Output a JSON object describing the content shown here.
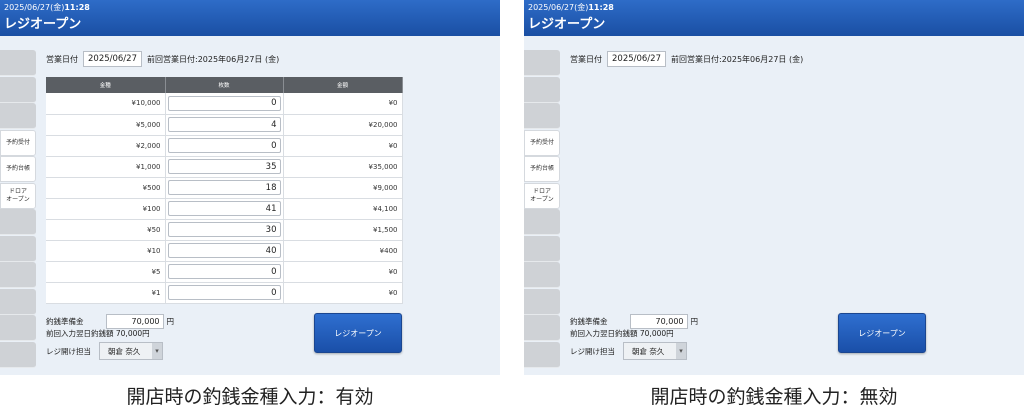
{
  "header": {
    "date": "2025/06/27(金)",
    "time": "11:28",
    "title": "レジオープン"
  },
  "sidebar": {
    "items": [
      "",
      "",
      "",
      "予約受付",
      "予約台帳",
      "ドロア\nオープン",
      "",
      "",
      "",
      "",
      "",
      ""
    ]
  },
  "business_date": {
    "label": "営業日付",
    "value": "2025/06/27",
    "prev": "前回営業日付:2025年06月27日 (金)"
  },
  "table": {
    "headers": [
      "金種",
      "枚数",
      "金額"
    ],
    "rows": [
      {
        "denom": "¥10,000",
        "count": "0",
        "amount": "¥0"
      },
      {
        "denom": "¥5,000",
        "count": "4",
        "amount": "¥20,000"
      },
      {
        "denom": "¥2,000",
        "count": "0",
        "amount": "¥0"
      },
      {
        "denom": "¥1,000",
        "count": "35",
        "amount": "¥35,000"
      },
      {
        "denom": "¥500",
        "count": "18",
        "amount": "¥9,000"
      },
      {
        "denom": "¥100",
        "count": "41",
        "amount": "¥4,100"
      },
      {
        "denom": "¥50",
        "count": "30",
        "amount": "¥1,500"
      },
      {
        "denom": "¥10",
        "count": "40",
        "amount": "¥400"
      },
      {
        "denom": "¥5",
        "count": "0",
        "amount": "¥0"
      },
      {
        "denom": "¥1",
        "count": "0",
        "amount": "¥0"
      }
    ]
  },
  "float": {
    "label": "釣銭準備金",
    "value": "70,000",
    "unit": "円"
  },
  "prev_float": {
    "label": "前回入力翌日釣銭額",
    "value": "70,000円"
  },
  "staff": {
    "label": "レジ開け担当",
    "value": "朝倉 奈久"
  },
  "open_button": "レジオープン",
  "captions": {
    "left": "開店時の釣銭金種入力：有効",
    "right": "開店時の釣銭金種入力：無効"
  }
}
